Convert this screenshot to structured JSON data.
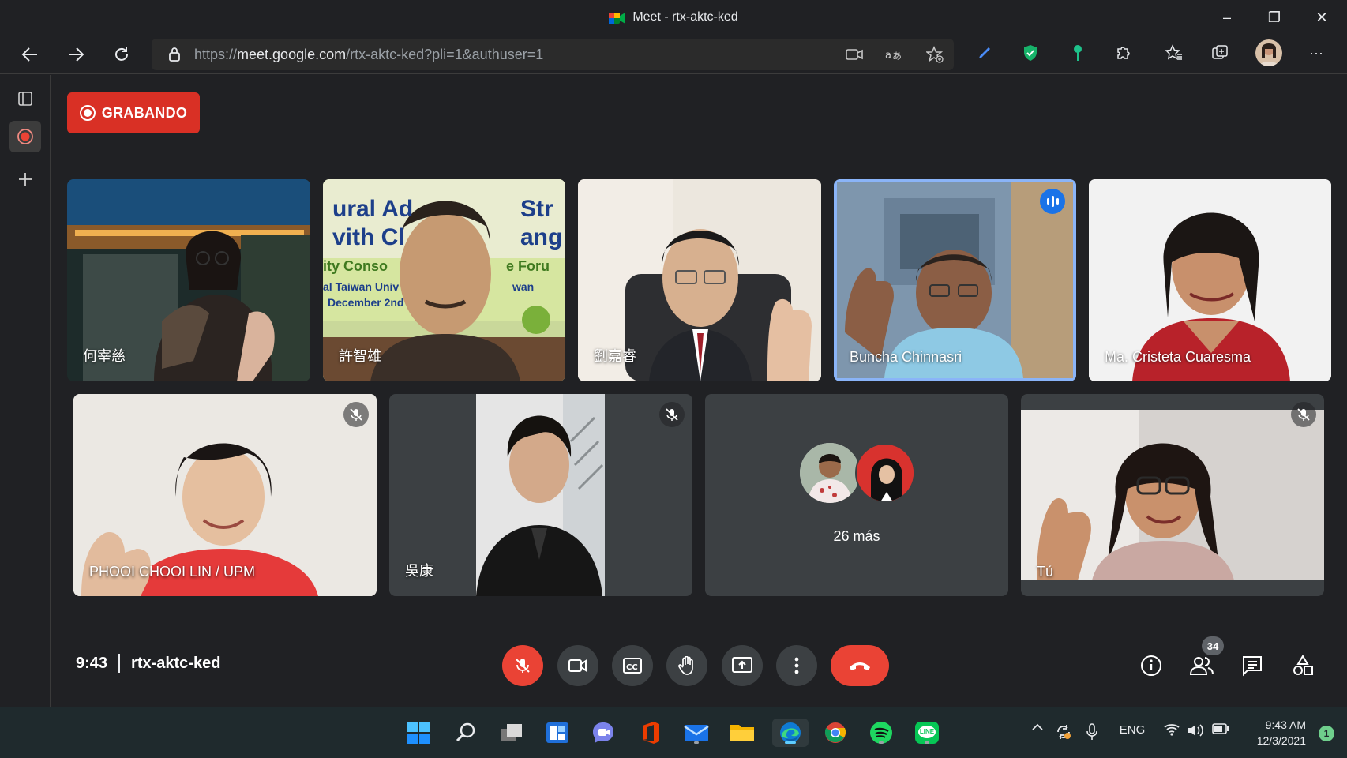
{
  "window": {
    "title": "Meet - rtx-aktc-ked",
    "minimize_glyph": "–",
    "restore_glyph": "❐",
    "close_glyph": "✕"
  },
  "browser": {
    "url_scheme": "https://",
    "url_host": "meet.google.com",
    "url_path": "/rtx-aktc-ked?pli=1&authuser=1",
    "more_glyph": "···"
  },
  "recording": {
    "label": "GRABANDO"
  },
  "participants": [
    {
      "name": "何宰慈",
      "muted": false,
      "speaking": false
    },
    {
      "name": "許智雄",
      "muted": false,
      "speaking": false
    },
    {
      "name": "劉嘉睿",
      "muted": false,
      "speaking": false
    },
    {
      "name": "Buncha Chinnasri",
      "muted": false,
      "speaking": true
    },
    {
      "name": "Ma. Cristeta Cuaresma",
      "muted": false,
      "speaking": false
    },
    {
      "name": "PHOOI CHOOI LIN / UPM",
      "muted": true,
      "speaking": false
    },
    {
      "name": "吳康",
      "muted": true,
      "speaking": false
    },
    {
      "name": "Tú",
      "muted": true,
      "speaking": false
    }
  ],
  "background_text": {
    "line1": "ural Ad",
    "line1b": "Str",
    "line2": "vith Cl",
    "line2b": "ang",
    "line3": "ity Conso",
    "line3b": "e Foru",
    "line4": "al Taiwan Univ",
    "line4b": "wan",
    "line5": "December 2nd"
  },
  "more_participants": {
    "label": "26 más"
  },
  "meeting": {
    "time": "9:43",
    "code": "rtx-aktc-ked",
    "participant_count": "34"
  },
  "controls": {
    "mic": "mic-off-icon",
    "camera": "camera-icon",
    "captions": "captions-icon",
    "raise_hand": "hand-icon",
    "present": "present-icon",
    "more": "more-vertical-icon",
    "end_call": "end-call-icon"
  },
  "taskbar": {
    "language": "ENG",
    "clock_time": "9:43 AM",
    "clock_date": "12/3/2021",
    "notifications": "1",
    "line_label": "LINE"
  },
  "colors": {
    "recording": "#d93025",
    "end_call": "#ea4335",
    "active_border": "#8ab4f8",
    "meet_background": "#202124"
  }
}
